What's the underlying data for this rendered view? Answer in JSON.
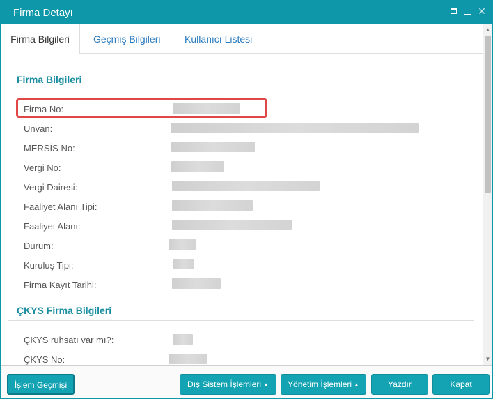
{
  "window": {
    "title": "Firma Detayı",
    "controls": {
      "maximize_icon": "maximize-icon",
      "minimize_icon": "minimize-icon",
      "close_symbol": "✕"
    }
  },
  "tabs": [
    {
      "label": "Firma Bilgileri",
      "active": true
    },
    {
      "label": "Geçmiş Bilgileri",
      "active": false
    },
    {
      "label": "Kullanıcı Listesi",
      "active": false
    }
  ],
  "sections": {
    "firma": {
      "title": "Firma Bilgileri",
      "fields": [
        {
          "label": "Firma No:"
        },
        {
          "label": "Unvan:"
        },
        {
          "label": "MERSİS No:"
        },
        {
          "label": "Vergi No:"
        },
        {
          "label": "Vergi Dairesi:"
        },
        {
          "label": "Faaliyet Alanı Tipi:"
        },
        {
          "label": "Faaliyet Alanı:"
        },
        {
          "label": "Durum:"
        },
        {
          "label": "Kuruluş Tipi:"
        },
        {
          "label": "Firma Kayıt Tarihi:"
        }
      ]
    },
    "ckys": {
      "title": "ÇKYS Firma Bilgileri",
      "fields": [
        {
          "label": "ÇKYS ruhsatı var mı?:"
        },
        {
          "label": "ÇKYS No:"
        }
      ]
    }
  },
  "footer": {
    "history_button": "İşlem Geçmişi",
    "external_button": "Dış Sistem İşlemleri",
    "management_button": "Yönetim İşlemleri",
    "print_button": "Yazdır",
    "close_button": "Kapat",
    "caret_symbol": "▲"
  },
  "colors": {
    "accent": "#0e97a8",
    "button": "#14a3b3",
    "section_title": "#1a8da0",
    "highlight_border": "#e04848"
  }
}
